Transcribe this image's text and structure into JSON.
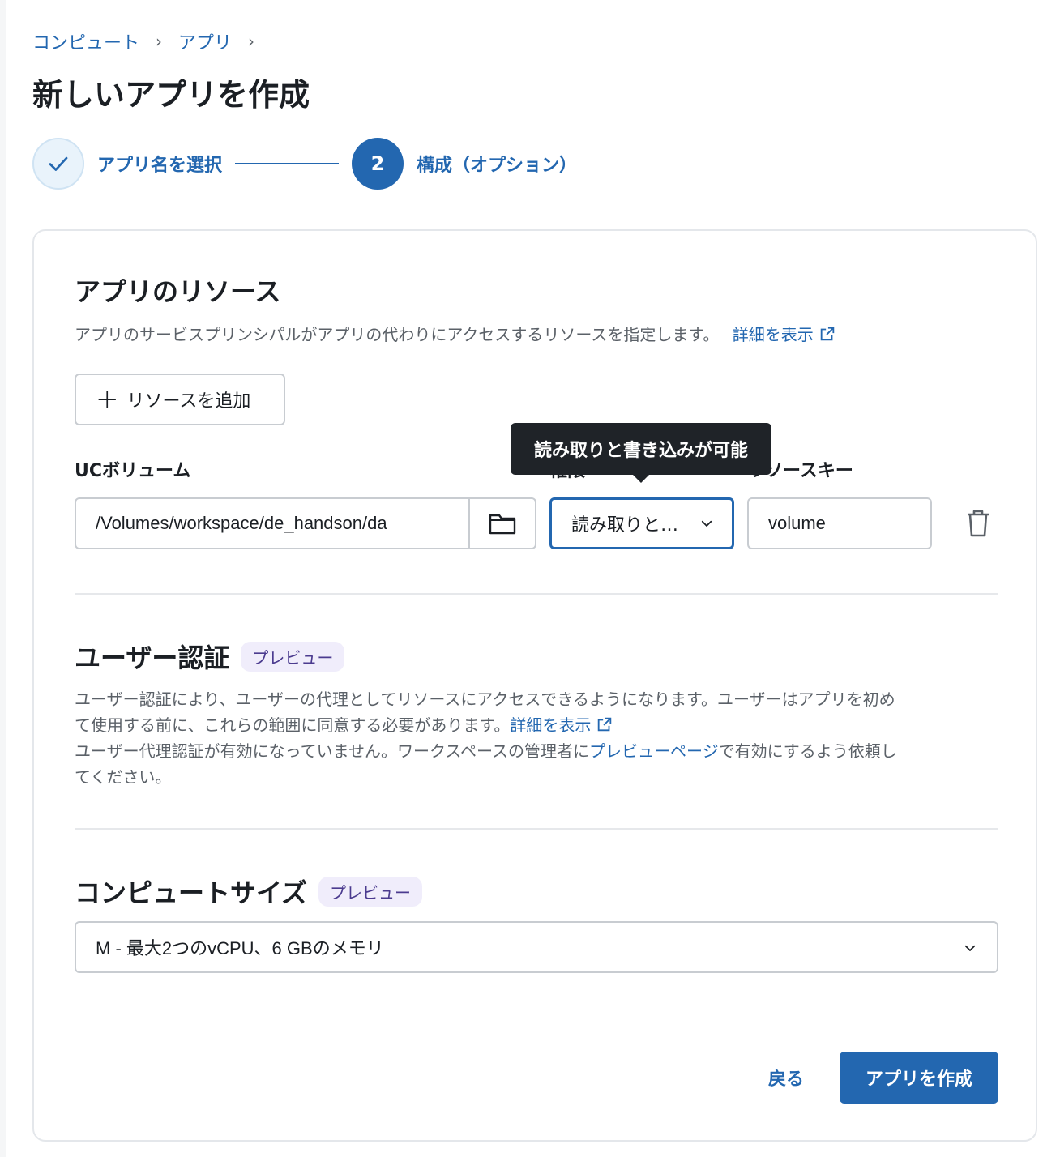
{
  "breadcrumb": {
    "items": [
      "コンピュート",
      "アプリ"
    ],
    "separator": "›"
  },
  "page_title": "新しいアプリを作成",
  "stepper": {
    "step1_label": "アプリ名を選択",
    "step2_number": "2",
    "step2_label": "構成（オプション）"
  },
  "resources": {
    "title": "アプリのリソース",
    "description": "アプリのサービスプリンシパルがアプリの代わりにアクセスするリソースを指定します。",
    "details_link": "詳細を表示",
    "add_button": "リソースを追加",
    "uc_volume_label": "UCボリューム",
    "permission_label": "権限",
    "resource_key_label": "リソースキー",
    "volume_path": "/Volumes/workspace/de_handson/da",
    "permission_value": "読み取りと…",
    "resource_key_value": "volume",
    "tooltip": "読み取りと書き込みが可能"
  },
  "user_auth": {
    "title": "ユーザー認証",
    "badge": "プレビュー",
    "desc_line1": "ユーザー認証により、ユーザーの代理としてリソースにアクセスできるようになります。ユーザーはアプリを初め",
    "desc_line2": "て使用する前に、これらの範囲に同意する必要があります。",
    "details_link": "詳細を表示",
    "desc_line3_pre": "ユーザー代理認証が有効になっていません。ワークスペースの管理者に",
    "preview_page_link": "プレビューページ",
    "desc_line3_post": "で有効にするよう依頼し",
    "desc_line4": "てください。"
  },
  "compute_size": {
    "title": "コンピュートサイズ",
    "badge": "プレビュー",
    "selected": "M - 最大2つのvCPU、6 GBのメモリ"
  },
  "footer": {
    "back": "戻る",
    "create": "アプリを作成"
  },
  "colors": {
    "accent": "#2367b0",
    "badge_bg": "#f0edfb",
    "tooltip_bg": "#1f2328"
  }
}
